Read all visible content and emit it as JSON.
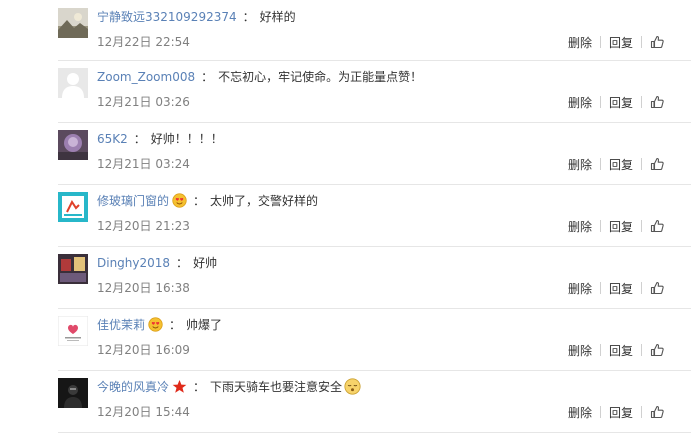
{
  "actions": {
    "delete_label": "删除",
    "reply_label": "回复",
    "like_icon": "thumbs-up-icon"
  },
  "comments": [
    {
      "username": "宁静致远332109292374",
      "badge": null,
      "text": "好样的",
      "emoji": null,
      "time": "12月22日 22:54",
      "avatar_style": "landscape"
    },
    {
      "username": "Zoom_Zoom008",
      "badge": null,
      "text": "不忘初心，牢记使命。为正能量点赞！",
      "emoji": null,
      "time": "12月21日 03:26",
      "avatar_style": "default-silhouette"
    },
    {
      "username": "65K2",
      "badge": null,
      "text": "好帅！！！！",
      "emoji": null,
      "time": "12月21日 03:24",
      "avatar_style": "purple-portrait"
    },
    {
      "username": "修玻璃门窗的",
      "badge": "heart-eyes-icon",
      "text": "太帅了，交警好样的",
      "emoji": null,
      "time": "12月20日 21:23",
      "avatar_style": "cyan-graphic"
    },
    {
      "username": "Dinghy2018",
      "badge": null,
      "text": "好帅",
      "emoji": null,
      "time": "12月20日 16:38",
      "avatar_style": "dark-photo"
    },
    {
      "username": "佳优茉莉",
      "badge": "heart-eyes-icon",
      "text": "帅爆了",
      "emoji": null,
      "time": "12月20日 16:09",
      "avatar_style": "white-logo"
    },
    {
      "username": "今晚的风真冷",
      "badge": "red-star-icon",
      "text": "下雨天骑车也要注意安全",
      "emoji": "sleepy-face-icon",
      "time": "12月20日 15:44",
      "avatar_style": "black-figure"
    }
  ]
}
